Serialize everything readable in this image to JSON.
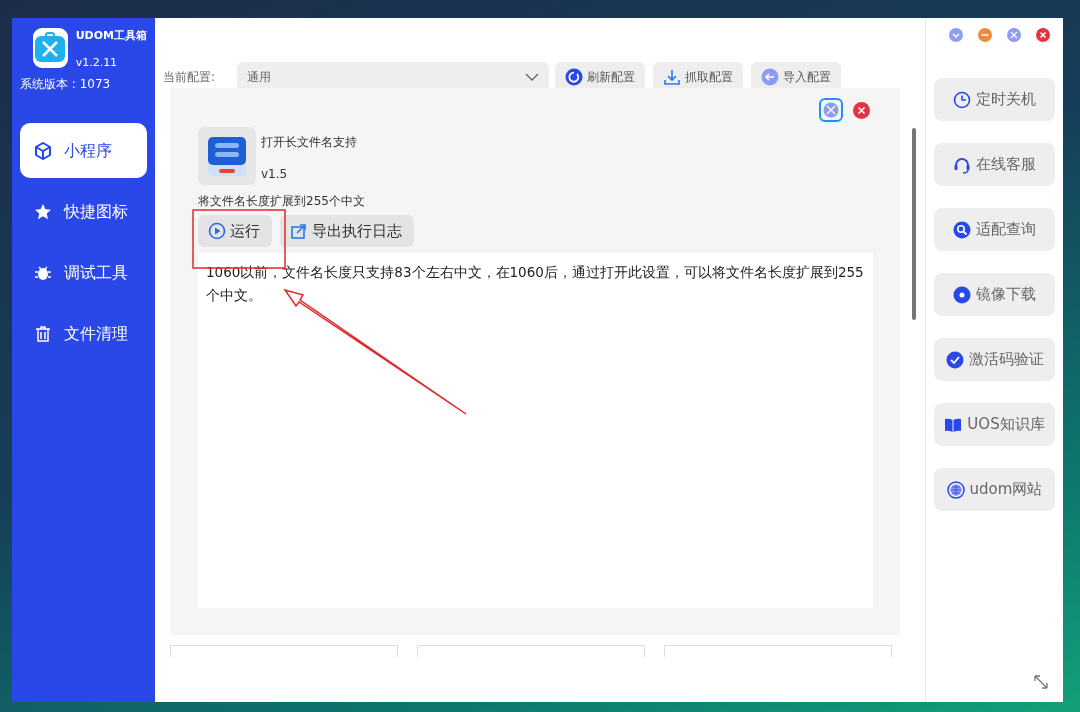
{
  "app": {
    "name": "UDOM工具箱",
    "version": "v1.2.11",
    "system_version": "系统版本 : 1073"
  },
  "nav": [
    {
      "label": "小程序",
      "kind": "cube",
      "selected": true
    },
    {
      "label": "快捷图标",
      "kind": "star",
      "selected": false
    },
    {
      "label": "调试工具",
      "kind": "bug",
      "selected": false
    },
    {
      "label": "文件清理",
      "kind": "trash",
      "selected": false
    }
  ],
  "window_controls": [
    {
      "kind": "menu"
    },
    {
      "kind": "minimize"
    },
    {
      "kind": "maximize"
    },
    {
      "kind": "close"
    }
  ],
  "config": {
    "label": "当前配置:",
    "value": "通用"
  },
  "toolbar": [
    {
      "label": "刷新配置",
      "kind": "refresh"
    },
    {
      "label": "抓取配置",
      "kind": "download"
    },
    {
      "label": "导入配置",
      "kind": "import"
    }
  ],
  "dialog": {
    "title": "打开长文件名支持",
    "version": "v1.5",
    "summary": "将文件名长度扩展到255个中文",
    "actions": [
      {
        "label": "运行",
        "kind": "play"
      },
      {
        "label": "导出执行日志",
        "kind": "export"
      }
    ],
    "output": "1060以前，文件名长度只支持83个左右中文，在1060后，通过打开此设置，可以将文件名长度扩展到255个中文。"
  },
  "side_actions": [
    {
      "label": "定时关机",
      "kind": "clock"
    },
    {
      "label": "在线客服",
      "kind": "headset"
    },
    {
      "label": "适配查询",
      "kind": "search"
    },
    {
      "label": "镜像下载",
      "kind": "disc"
    },
    {
      "label": "激活码验证",
      "kind": "check"
    },
    {
      "label": "UOS知识库",
      "kind": "book"
    },
    {
      "label": "udom网站",
      "kind": "globe"
    }
  ]
}
